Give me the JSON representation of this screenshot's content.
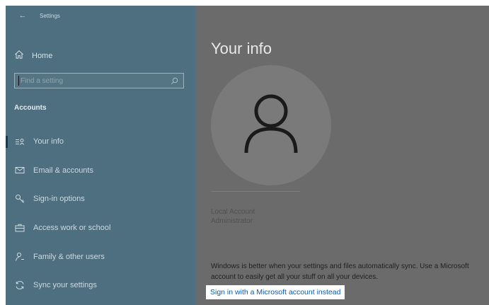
{
  "titlebar": {
    "back_label": "←",
    "title": "Settings"
  },
  "sidebar": {
    "home_label": "Home",
    "search": {
      "placeholder": "Find a setting",
      "value": ""
    },
    "section_heading": "Accounts",
    "items": [
      {
        "label": "Your info",
        "icon": "person-card-icon",
        "selected": true
      },
      {
        "label": "Email & accounts",
        "icon": "mail-icon",
        "selected": false
      },
      {
        "label": "Sign-in options",
        "icon": "key-icon",
        "selected": false
      },
      {
        "label": "Access work or school",
        "icon": "briefcase-icon",
        "selected": false
      },
      {
        "label": "Family & other users",
        "icon": "person-add-icon",
        "selected": false
      },
      {
        "label": "Sync your settings",
        "icon": "sync-icon",
        "selected": false
      }
    ]
  },
  "main": {
    "title": "Your info",
    "account_name": "Local Account",
    "account_type": "Administrator",
    "sync_text": "Windows is better when your settings and files automatically sync. Use a Microsoft account to easily get all your stuff on all your devices.",
    "signin_link": "Sign in with a Microsoft account instead"
  },
  "colors": {
    "sidebar_bg": "#4d6f80",
    "main_bg": "#6b6b6b",
    "link": "#0a5cb0"
  }
}
